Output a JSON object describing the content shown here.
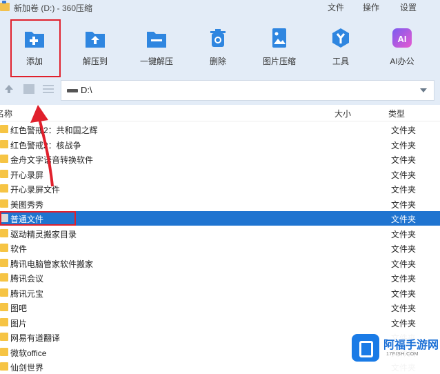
{
  "window": {
    "title": "新加卷 (D:) - 360压缩"
  },
  "menu": [
    {
      "label": "文件"
    },
    {
      "label": "操作"
    },
    {
      "label": "设置"
    }
  ],
  "toolbar": [
    {
      "label": "添加",
      "icon": "add-icon"
    },
    {
      "label": "解压到",
      "icon": "extract-icon"
    },
    {
      "label": "一键解压",
      "icon": "one-click-extract-icon"
    },
    {
      "label": "删除",
      "icon": "delete-icon"
    },
    {
      "label": "图片压缩",
      "icon": "image-compress-icon"
    },
    {
      "label": "工具",
      "icon": "tools-icon"
    },
    {
      "label": "AI办公",
      "icon": "ai-office-icon"
    }
  ],
  "address": {
    "path": "D:\\"
  },
  "columns": {
    "name": "名称",
    "size": "大小",
    "type": "类型"
  },
  "files": [
    {
      "name": "红色警戒2：共和国之辉",
      "type": "文件夹"
    },
    {
      "name": "红色警戒2：核战争",
      "type": "文件夹"
    },
    {
      "name": "金舟文字语音转换软件",
      "type": "文件夹"
    },
    {
      "name": "开心录屏",
      "type": "文件夹"
    },
    {
      "name": "开心录屏文件",
      "type": "文件夹"
    },
    {
      "name": "美图秀秀",
      "type": "文件夹"
    },
    {
      "name": "普通文件",
      "type": "文件夹",
      "selected": true
    },
    {
      "name": "驱动精灵搬家目录",
      "type": "文件夹"
    },
    {
      "name": "软件",
      "type": "文件夹"
    },
    {
      "name": "腾讯电脑管家软件搬家",
      "type": "文件夹"
    },
    {
      "name": "腾讯会议",
      "type": "文件夹"
    },
    {
      "name": "腾讯元宝",
      "type": "文件夹"
    },
    {
      "name": "图吧",
      "type": "文件夹"
    },
    {
      "name": "图片",
      "type": "文件夹"
    },
    {
      "name": "网易有道翻译",
      "type": "文件夹"
    },
    {
      "name": "微软office",
      "type": "文件夹"
    },
    {
      "name": "仙剑世界",
      "type": "文件夹"
    }
  ],
  "watermark": {
    "name": "阿福手游网",
    "url": "17FISH.COM"
  },
  "colors": {
    "accent": "#1f74d0",
    "toolbar_bg": "#e3ecf7",
    "annotation": "#e0202c",
    "folder": "#f6c444"
  }
}
